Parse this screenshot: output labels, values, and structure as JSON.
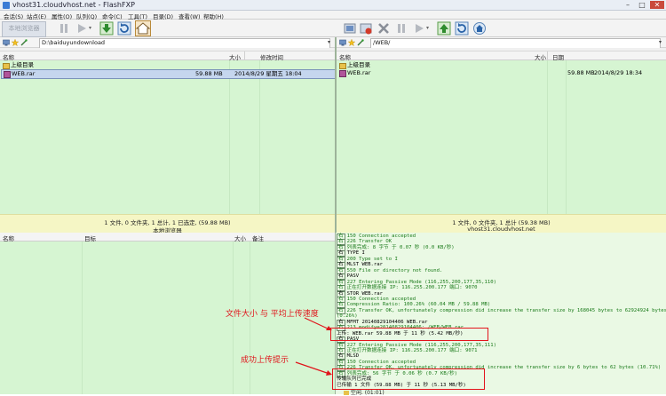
{
  "window": {
    "title": "vhost31.cloudvhost.net - FlashFXP",
    "min": "–",
    "max": "□",
    "close": "✕"
  },
  "menu": [
    "会话(S)",
    "站点(E)",
    "属性(O)",
    "队列(Q)",
    "命令(C)",
    "工具(T)",
    "目录(D)",
    "查看(W)",
    "帮助(H)"
  ],
  "toolbar": {
    "local_browser_label": "本地浏览器"
  },
  "left": {
    "path": "D:\\baiduyundownload",
    "columns": [
      "名称",
      "大小",
      "修改时间"
    ],
    "rows": [
      {
        "name": "上级目录",
        "size": "",
        "date": ""
      },
      {
        "name": "WEB.rar",
        "size": "59.88 MB",
        "date": "2014/8/29 星期五 18:04"
      }
    ],
    "status": "1 文件, 0 文件夹, 1 总计, 1 已选定, (59.88 MB)",
    "label": "本地浏览器"
  },
  "right": {
    "path": "/WEB/",
    "columns": [
      "名称",
      "大小",
      "日期"
    ],
    "rows": [
      {
        "name": "上级目录",
        "size": "",
        "date": ""
      },
      {
        "name": "WEB.rar",
        "size": "59.88 MB",
        "date": "2014/8/29 18:34"
      }
    ],
    "status": "1 文件, 0 文件夹, 1 总计 (59.38 MB)",
    "label": "vhost31.cloudvhost.net"
  },
  "queue": {
    "columns": [
      "名称",
      "目标",
      "大小",
      "备注"
    ]
  },
  "log": [
    {
      "tag": "右",
      "text": "150 Connection accepted",
      "color": "#1a7a1a"
    },
    {
      "tag": "右",
      "text": "226 Transfer OK",
      "color": "#1a7a1a"
    },
    {
      "tag": "右",
      "text": "列表完成: 8 字节 于 0.07 秒 (0.0 KB/秒)",
      "color": "#1a7a1a"
    },
    {
      "tag": "右",
      "text": "TYPE I",
      "color": "#000000"
    },
    {
      "tag": "右",
      "text": "200 Type set to I",
      "color": "#1a7a1a"
    },
    {
      "tag": "右",
      "text": "MLST WEB.rar",
      "color": "#000000"
    },
    {
      "tag": "右",
      "text": "550 File or directory not found.",
      "color": "#1a7a1a"
    },
    {
      "tag": "右",
      "text": "PASV",
      "color": "#000000"
    },
    {
      "tag": "右",
      "text": "227 Entering Passive Mode (116,255,200,177,35,110)",
      "color": "#1a7a1a"
    },
    {
      "tag": "右",
      "text": "正在打开数据连接 IP: 116.255.200.177 端口: 9070",
      "color": "#1a7a1a"
    },
    {
      "tag": "右",
      "text": "STOR WEB.rar",
      "color": "#000000"
    },
    {
      "tag": "右",
      "text": "150 Connection accepted",
      "color": "#1a7a1a"
    },
    {
      "tag": "右",
      "text": "Compression Ratio: 100.26% (60.04 MB / 59.88 MB)",
      "color": "#1a7a1a"
    },
    {
      "tag": "右",
      "text": "226 Transfer OK, unfortunately compression did increase the transfer size by 168045 bytes to 62924924 bytes",
      "color": "#1a7a1a"
    },
    {
      "tag": "",
      "text": "(0.26%)",
      "color": "#1a7a1a"
    },
    {
      "tag": "右",
      "text": "MFMT 20140829104406 WEB.rar",
      "color": "#000000"
    },
    {
      "tag": "右",
      "text": "213 modify=20140829104406; /WEB/WEB.rar",
      "color": "#1a7a1a"
    },
    {
      "tag": "",
      "text": "上传: WEB.rar 59.88 MB 于 11 秒 (5.42 MB/秒)",
      "color": "#000000"
    },
    {
      "tag": "右",
      "text": "PASV",
      "color": "#000000"
    },
    {
      "tag": "右",
      "text": "227 Entering Passive Mode (116,255,200,177,35,111)",
      "color": "#1a7a1a"
    },
    {
      "tag": "右",
      "text": "正在打开数据连接 IP: 116.255.200.177 端口: 9071",
      "color": "#1a7a1a"
    },
    {
      "tag": "右",
      "text": "MLSD",
      "color": "#000000"
    },
    {
      "tag": "右",
      "text": "150 Connection accepted",
      "color": "#1a7a1a"
    },
    {
      "tag": "右",
      "text": "226 Transfer OK, unfortunately compression did increase the transfer size by 6 bytes to 62 bytes (10.71%)",
      "color": "#1a7a1a"
    },
    {
      "tag": "右",
      "text": "列表完成: 56 字节 于 0.06 秒 (0.7 KB/秒)",
      "color": "#1a7a1a"
    },
    {
      "tag": "",
      "text": "传输队列已完成",
      "color": "#000000"
    },
    {
      "tag": "",
      "text": "已传输 1 文件 (59.88 MB) 于 11 秒 (5.13 MB/秒)",
      "color": "#000000"
    }
  ],
  "idle": "空闲. (01:01)",
  "annotations": {
    "speed": "文件大小 与 平均上传速度",
    "success": "成功上传提示"
  },
  "colors": {
    "pane_bg": "#d6f5d2",
    "status_bg": "#f5f6c5",
    "highlight": "#e3141b"
  }
}
